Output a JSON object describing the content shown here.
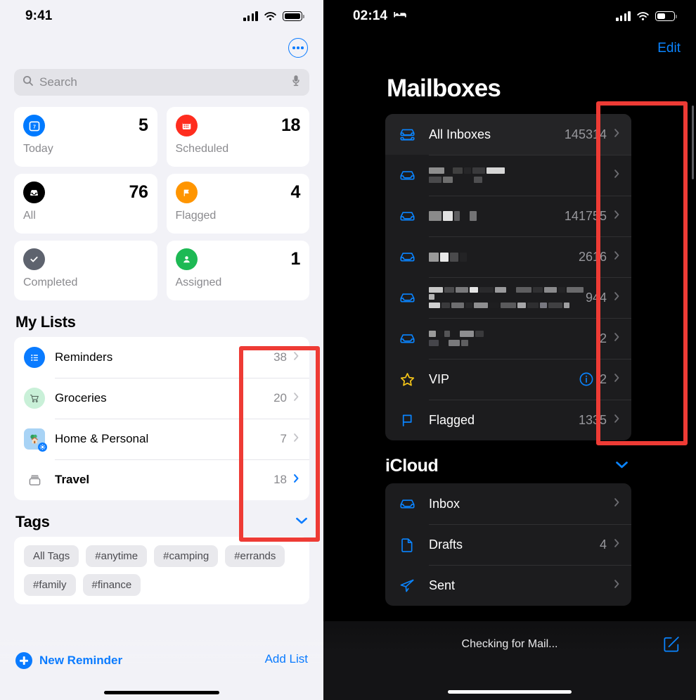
{
  "left_panel": {
    "app": "Reminders",
    "status_bar": {
      "time": "9:41",
      "signal_icon": "cellular-bars-icon",
      "wifi_icon": "wifi-icon",
      "battery_icon": "battery-icon"
    },
    "more_button": "more-options-icon",
    "search": {
      "placeholder": "Search",
      "search_icon": "search-icon",
      "mic_icon": "microphone-icon"
    },
    "smart_lists": [
      {
        "label": "Today",
        "count": "5",
        "icon": "calendar-day-icon",
        "color": "#007aff"
      },
      {
        "label": "Scheduled",
        "count": "18",
        "icon": "calendar-icon",
        "color": "#ff2d1f"
      },
      {
        "label": "All",
        "count": "76",
        "icon": "inbox-tray-icon",
        "color": "#000000"
      },
      {
        "label": "Flagged",
        "count": "4",
        "icon": "flag-icon",
        "color": "#ff9500"
      },
      {
        "label": "Completed",
        "count": "",
        "icon": "checkmark-icon",
        "color": "#5e636e"
      },
      {
        "label": "Assigned",
        "count": "1",
        "icon": "person-icon",
        "color": "#1db954"
      }
    ],
    "my_lists": {
      "title": "My Lists",
      "rows": [
        {
          "label": "Reminders",
          "count": "38",
          "icon": "bulleted-list-icon",
          "selected": false
        },
        {
          "label": "Groceries",
          "count": "20",
          "icon": "shopping-cart-icon",
          "selected": false
        },
        {
          "label": "Home & Personal",
          "count": "7",
          "icon": "house-tree-icon",
          "selected": false
        },
        {
          "label": "Travel",
          "count": "18",
          "icon": "suitcase-icon",
          "selected": true
        }
      ]
    },
    "tags": {
      "title": "Tags",
      "chevron_icon": "chevron-down-icon",
      "items": [
        "All Tags",
        "#anytime",
        "#camping",
        "#errands",
        "#family",
        "#finance"
      ]
    },
    "toolbar": {
      "new_reminder": "New Reminder",
      "add_list": "Add List",
      "plus_icon": "plus-circle-icon"
    }
  },
  "right_panel": {
    "app": "Mail",
    "status_bar": {
      "time": "02:14",
      "sleep_icon": "bed-sleep-icon",
      "signal_icon": "cellular-bars-icon",
      "wifi_icon": "wifi-icon",
      "battery_icon": "battery-icon"
    },
    "edit_label": "Edit",
    "title": "Mailboxes",
    "mailboxes": [
      {
        "label": "All Inboxes",
        "count": "145314",
        "icon": "all-inboxes-icon",
        "redacted": false,
        "info": false
      },
      {
        "label": "",
        "count": "",
        "icon": "inbox-icon",
        "redacted": true,
        "info": false,
        "redact_rows": [
          [
            22,
            9
          ],
          [
            14,
            9
          ],
          [
            8,
            9
          ],
          [
            18,
            9
          ],
          [
            26,
            9
          ],
          [
            30,
            9
          ],
          [
            26,
            9
          ],
          [
            14,
            9
          ]
        ]
      },
      {
        "label": "",
        "count": "141755",
        "icon": "inbox-icon",
        "redacted": true,
        "info": false,
        "redact_rows": [
          [
            34,
            9
          ],
          [
            16,
            9
          ],
          [
            12,
            9
          ],
          [
            10,
            9
          ]
        ]
      },
      {
        "label": "",
        "count": "2616",
        "icon": "inbox-icon",
        "redacted": true,
        "info": false,
        "redact_rows": [
          [
            20,
            9
          ],
          [
            30,
            9
          ],
          [
            12,
            9
          ]
        ]
      },
      {
        "label": "",
        "count": "944",
        "icon": "inbox-icon",
        "redacted": true,
        "info": false,
        "redact_rows": [
          [
            30,
            9
          ],
          [
            18,
            9
          ],
          [
            26,
            9
          ],
          [
            22,
            9
          ],
          [
            34,
            9
          ],
          [
            18,
            9
          ],
          [
            26,
            9
          ],
          [
            14,
            9
          ],
          [
            22,
            9
          ],
          [
            30,
            9
          ],
          [
            10,
            9
          ],
          [
            26,
            9
          ],
          [
            8,
            9
          ]
        ]
      },
      {
        "label": "",
        "count": "2",
        "icon": "inbox-icon",
        "redacted": true,
        "info": false,
        "redact_rows": [
          [
            10,
            9
          ],
          [
            14,
            9
          ],
          [
            8,
            9
          ],
          [
            20,
            9
          ],
          [
            12,
            9
          ],
          [
            16,
            9
          ]
        ]
      },
      {
        "label": "VIP",
        "count": "2",
        "icon": "star-icon",
        "redacted": false,
        "info": true,
        "info_icon": "info-circle-icon"
      },
      {
        "label": "Flagged",
        "count": "1335",
        "icon": "flag-outline-icon",
        "redacted": false,
        "info": false
      }
    ],
    "icloud": {
      "title": "iCloud",
      "chevron_icon": "chevron-down-icon",
      "rows": [
        {
          "label": "Inbox",
          "count": "",
          "icon": "inbox-icon"
        },
        {
          "label": "Drafts",
          "count": "4",
          "icon": "document-icon"
        },
        {
          "label": "Sent",
          "count": "",
          "icon": "paper-plane-icon"
        }
      ]
    },
    "toolbar": {
      "status": "Checking for Mail...",
      "compose_icon": "compose-icon"
    }
  },
  "annotations": {
    "boxes": [
      {
        "name": "left-count-column-highlight",
        "color": "#ee3b35"
      },
      {
        "name": "right-count-column-highlight",
        "color": "#ee3b35"
      }
    ]
  }
}
